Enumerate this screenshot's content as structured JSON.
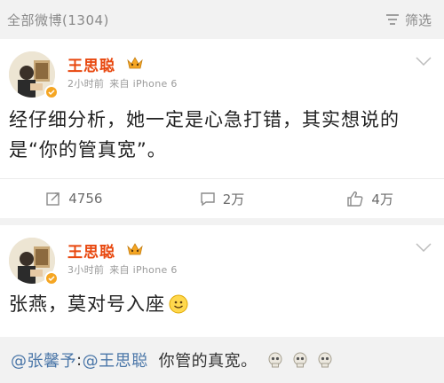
{
  "filter_bar": {
    "count_label": "全部微博(1304)",
    "filter_label": "筛选",
    "filter_icon": "filter-icon"
  },
  "posts": [
    {
      "author": "王思聪",
      "time": "2小时前",
      "source": "来自 iPhone 6",
      "content_line1": "经仔细分析，她一定是心急打错，其实想说的",
      "content_line2": "是“你的管真宽”。",
      "repost_count": "4756",
      "comment_count": "2万",
      "like_count": "4万"
    },
    {
      "author": "王思聪",
      "time": "3小时前",
      "source": "来自 iPhone 6",
      "content": "张燕，莫对号入座"
    }
  ],
  "comment_bar": {
    "mention1": "@张馨予",
    "separator": ":",
    "mention2": "@王思聪",
    "text": "你管的真宽。"
  },
  "colors": {
    "name": "#e8470e",
    "mention": "#4a76a8",
    "muted": "#9a9a9a",
    "background": "#f2f2f2"
  }
}
